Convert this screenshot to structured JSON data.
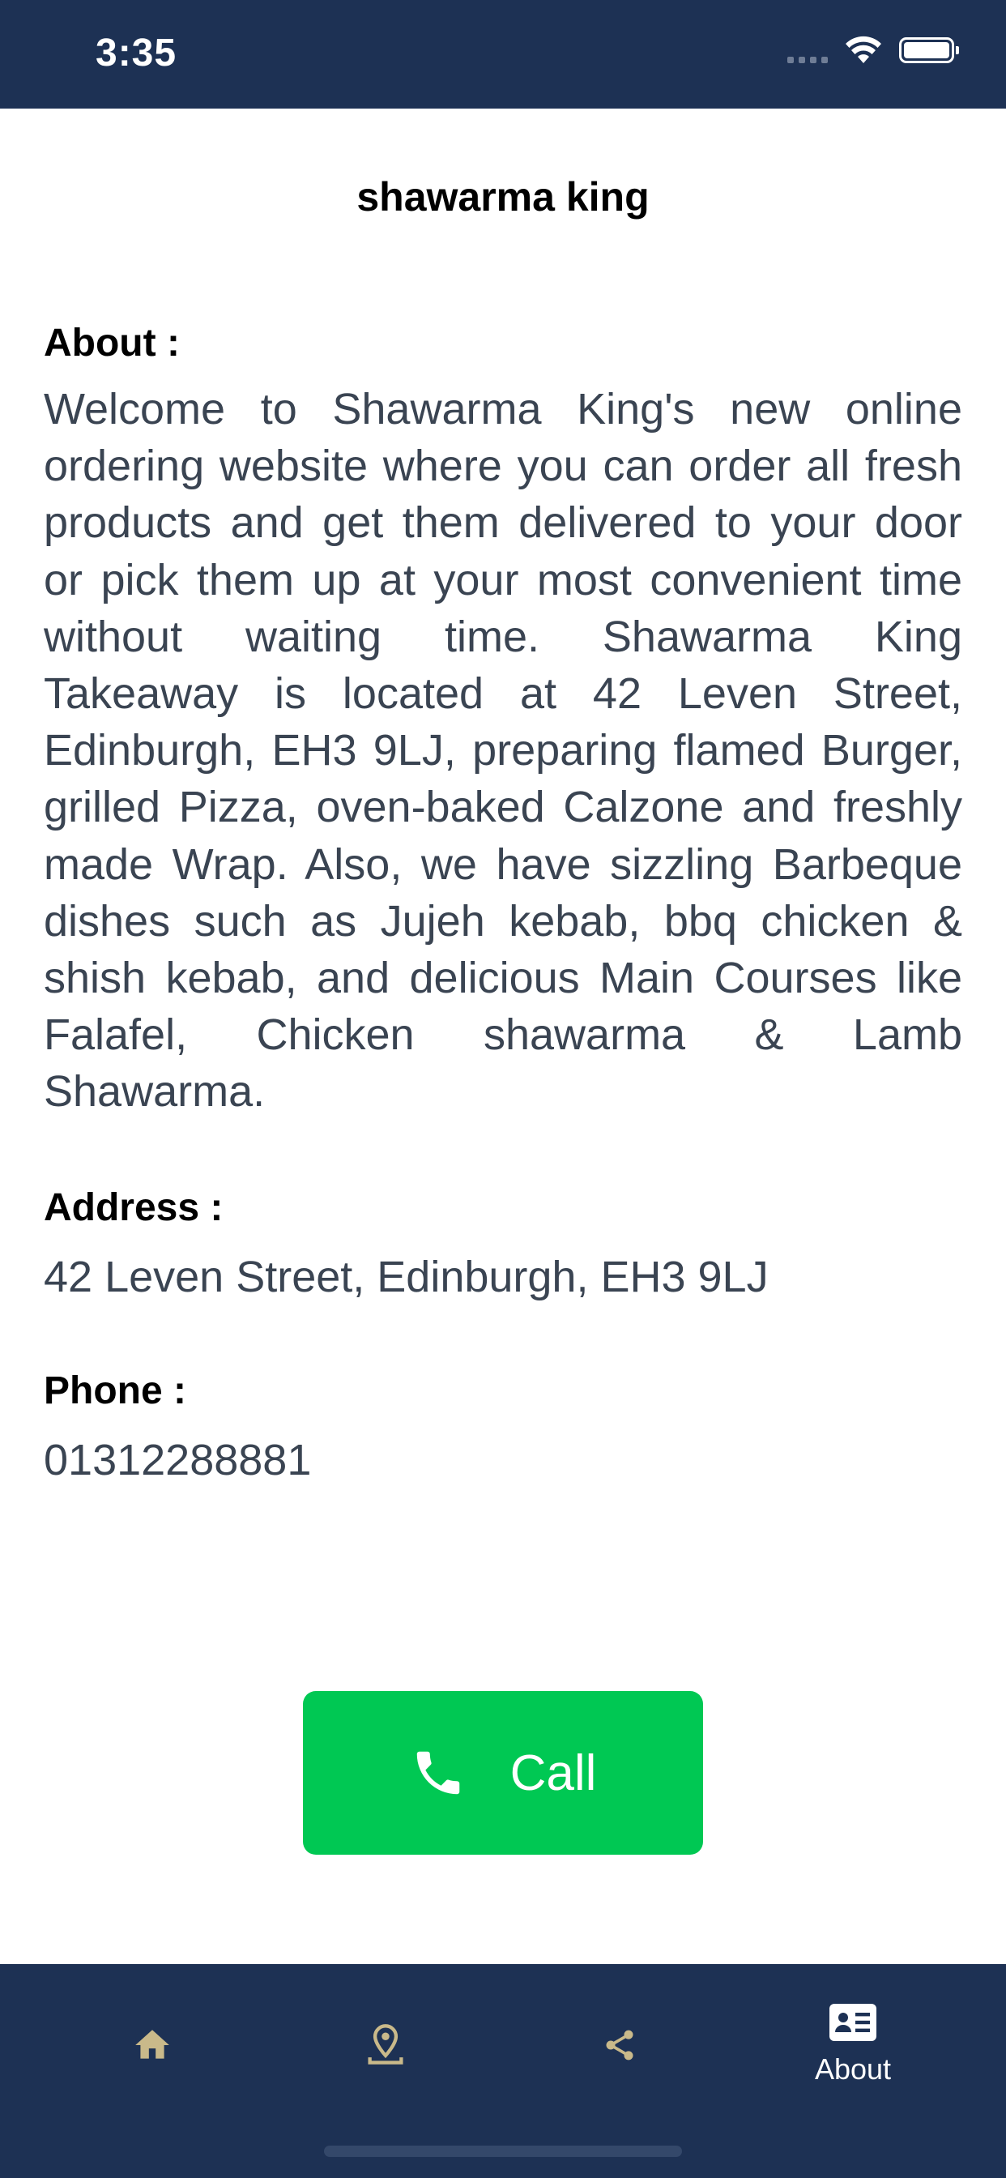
{
  "status_bar": {
    "time": "3:35"
  },
  "header": {
    "title": "shawarma king"
  },
  "about": {
    "label": "About :",
    "text": "Welcome to Shawarma King's new online ordering website where you can order all fresh products and get them delivered to your door or pick them up at your most convenient time without waiting time. Shawarma King Takeaway is located at 42 Leven Street, Edinburgh, EH3 9LJ, preparing flamed Burger, grilled Pizza, oven-baked Calzone and freshly made Wrap. Also, we have sizzling Barbeque dishes such as Jujeh kebab, bbq chicken & shish kebab, and delicious Main Courses like Falafel, Chicken shawarma & Lamb Shawarma."
  },
  "address": {
    "label": "Address :",
    "value": "42 Leven Street, Edinburgh, EH3 9LJ"
  },
  "phone": {
    "label": "Phone :",
    "value": "01312288881"
  },
  "call_button": {
    "label": "Call",
    "icon": "phone-icon",
    "color": "#00c853"
  },
  "tab_bar": {
    "background": "#1d3154",
    "inactive_color": "#c9b98a",
    "tabs": [
      {
        "icon": "home-icon",
        "label": "",
        "active": false
      },
      {
        "icon": "location-pin-icon",
        "label": "",
        "active": false
      },
      {
        "icon": "share-icon",
        "label": "",
        "active": false
      },
      {
        "icon": "contact-card-icon",
        "label": "About",
        "active": true
      }
    ]
  }
}
